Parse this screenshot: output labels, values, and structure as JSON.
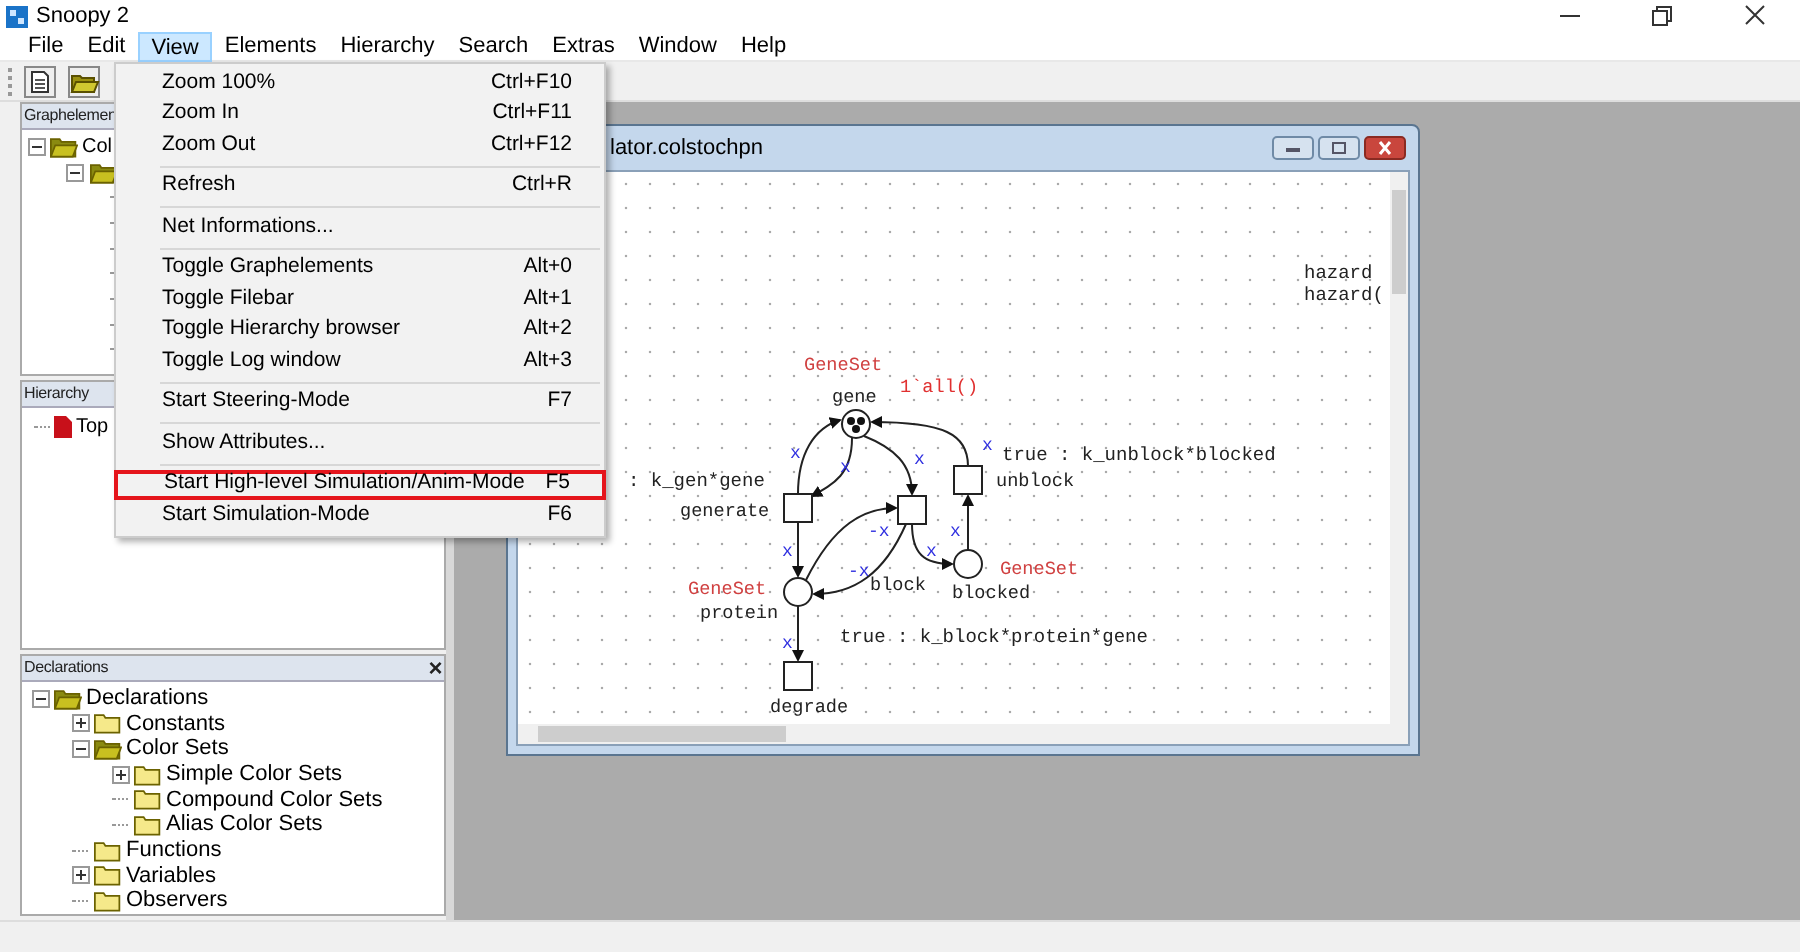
{
  "window": {
    "title": "Snoopy 2"
  },
  "menu_bar": [
    {
      "label": "File",
      "selected": false
    },
    {
      "label": "Edit",
      "selected": false
    },
    {
      "label": "View",
      "selected": true
    },
    {
      "label": "Elements",
      "selected": false
    },
    {
      "label": "Hierarchy",
      "selected": false
    },
    {
      "label": "Search",
      "selected": false
    },
    {
      "label": "Extras",
      "selected": false
    },
    {
      "label": "Window",
      "selected": false
    },
    {
      "label": "Help",
      "selected": false
    }
  ],
  "view_menu": {
    "groups": [
      [
        {
          "label": "Zoom 100%",
          "shortcut": "Ctrl+F10",
          "highlighted": false
        },
        {
          "label": "Zoom In",
          "shortcut": "Ctrl+F11",
          "highlighted": false
        },
        {
          "label": "Zoom Out",
          "shortcut": "Ctrl+F12",
          "highlighted": false
        }
      ],
      [
        {
          "label": "Refresh",
          "shortcut": "Ctrl+R",
          "highlighted": false
        }
      ],
      [
        {
          "label": "Net Informations...",
          "highlighted": false
        }
      ],
      [
        {
          "label": "Toggle Graphelements",
          "shortcut": "Alt+0",
          "highlighted": false
        },
        {
          "label": "Toggle Filebar",
          "shortcut": "Alt+1",
          "highlighted": false
        },
        {
          "label": "Toggle Hierarchy browser",
          "shortcut": "Alt+2",
          "highlighted": false
        },
        {
          "label": "Toggle Log window",
          "shortcut": "Alt+3",
          "highlighted": false
        }
      ],
      [
        {
          "label": "Start Steering-Mode",
          "shortcut": "F7",
          "highlighted": false
        }
      ],
      [
        {
          "label": "Show Attributes...",
          "highlighted": false
        }
      ],
      [
        {
          "label": "Start High-level Simulation/Anim-Mode",
          "shortcut": "F5",
          "highlighted": true
        },
        {
          "label": "Start Simulation-Mode",
          "shortcut": "F6",
          "highlighted": false
        }
      ]
    ]
  },
  "graphelements_panel": {
    "title": "Graphelemen",
    "tree": [
      {
        "label": "Col",
        "expanded": true
      }
    ]
  },
  "hierarchy_panel": {
    "title": "Hierarchy",
    "items": [
      {
        "label": "Top"
      }
    ]
  },
  "declarations_panel": {
    "title": "Declarations",
    "close": "×",
    "tree": [
      {
        "label": "Declarations",
        "expanded": true,
        "children": [
          {
            "label": "Constants",
            "expanded": false
          },
          {
            "label": "Color Sets",
            "expanded": true,
            "children": [
              {
                "label": "Simple Color Sets",
                "expanded": false
              },
              {
                "label": "Compound Color Sets"
              },
              {
                "label": "Alias Color Sets"
              }
            ]
          },
          {
            "label": "Functions"
          },
          {
            "label": "Variables",
            "expanded": false
          },
          {
            "label": "Observers"
          }
        ]
      }
    ]
  },
  "child_window": {
    "title": "lator.colstochpn",
    "places": [
      {
        "name": "gene",
        "colorset": "GeneSet",
        "marking": "1`all()",
        "tokens": true
      },
      {
        "name": "protein",
        "colorset": "GeneSet",
        "tokens": false
      },
      {
        "name": "blocked",
        "colorset": "GeneSet",
        "tokens": false
      }
    ],
    "transitions": [
      {
        "name": "generate"
      },
      {
        "name": "block"
      },
      {
        "name": "unblock"
      },
      {
        "name": "degrade"
      }
    ],
    "rate_labels": [
      ": k_gen*gene",
      "true : k_unblock*blocked",
      "true : k_block*protein*gene"
    ],
    "arc_labels": [
      "x",
      "x",
      "x",
      "x",
      "-x",
      "-x",
      "x",
      "x",
      "x",
      "x"
    ],
    "hazard_labels": [
      "hazard",
      "hazard("
    ]
  }
}
